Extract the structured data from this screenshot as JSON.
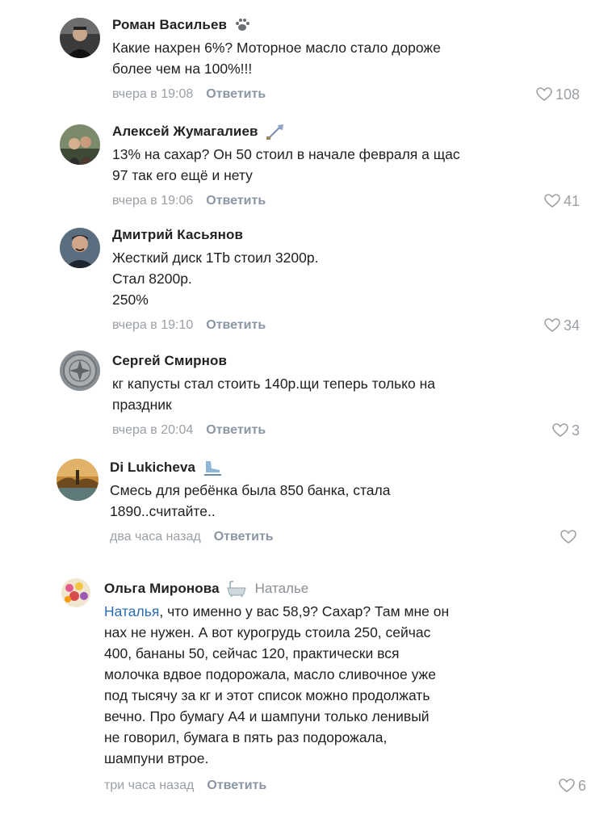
{
  "comments": [
    {
      "author": "Роман Васильев",
      "badge_icon": "paw-icon",
      "text": "Какие нахрен 6%? Моторное масло стало дороже\nболее чем на 100%!!!",
      "time": "вчера в 19:08",
      "reply_label": "Ответить",
      "likes": "108"
    },
    {
      "author": "Алексей Жумагалиев",
      "badge_icon": "shovel-icon",
      "text": "13% на сахар? Он 50 стоил в начале февраля а щас\n97 так его ещё и нету",
      "time": "вчера в 19:06",
      "reply_label": "Ответить",
      "likes": "41"
    },
    {
      "author": "Дмитрий Касьянов",
      "text": "Жесткий диск 1Tb стоил 3200р.\nСтал 8200р.\n250%",
      "time": "вчера в 19:10",
      "reply_label": "Ответить",
      "likes": "34"
    },
    {
      "author": "Сергей Смирнов",
      "text": "кг капусты стал стоить 140р.щи теперь только на\nпраздник",
      "time": "вчера в 20:04",
      "reply_label": "Ответить",
      "likes": "3"
    },
    {
      "author": "Di Lukicheva",
      "badge_icon": "ice-skate-icon",
      "text": "Смесь для ребёнка была 850 банка, стала\n1890..считайте..",
      "time": "два часа назад",
      "reply_label": "Ответить",
      "likes": ""
    },
    {
      "author": "Ольга Миронова",
      "badge_icon": "bathtub-icon",
      "reply_to": "Наталье",
      "mention": "Наталья",
      "text": ", что именно у вас 58,9? Сахар? Там мне он\nнах не нужен. А вот курогрудь стоила 250, сейчас\n400, бананы 50, сейчас 120, практически вся\nмолочка вдвое подорожала, масло сливочное уже\nпод тысячу за кг и этот список можно продолжать\nвечно. Про бумагу А4 и шампуни только ленивый\nне говорил, бумага в пять раз подорожала,\nшампуни втрое.",
      "time": "три часа назад",
      "reply_label": "Ответить",
      "likes": "6"
    }
  ],
  "colors": {
    "mention": "#2a6db3",
    "meta": "#9aa0a6",
    "reply": "#8a96a3"
  }
}
